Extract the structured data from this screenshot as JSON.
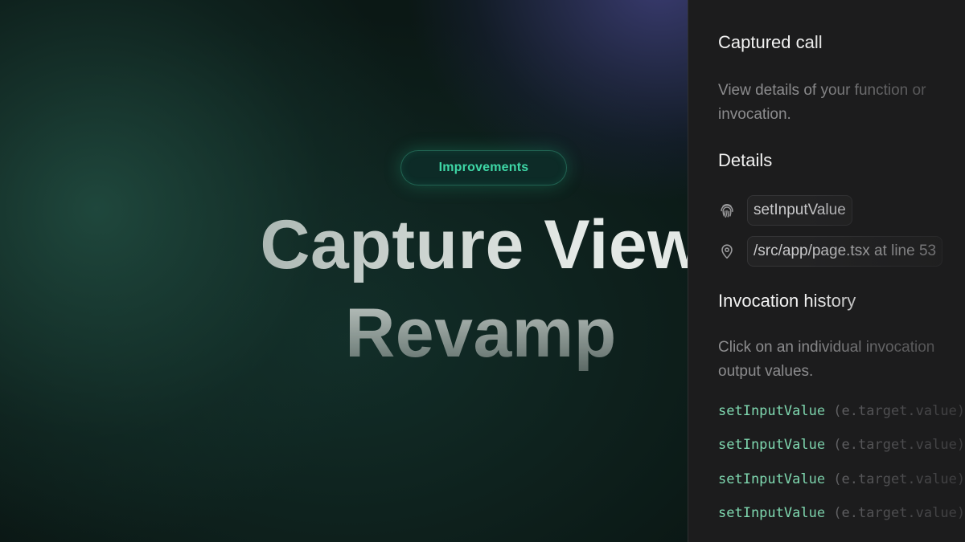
{
  "hero": {
    "badge_label": "Improvements",
    "title_line1": "Capture View",
    "title_line2": "Revamp"
  },
  "panel": {
    "title": "Captured call",
    "description": "View details of your function or invocation.",
    "description_line1": "View details of your function or",
    "description_line2": "invocation.",
    "details_heading": "Details",
    "details": [
      {
        "icon": "fingerprint-icon",
        "value": "setInputValue"
      },
      {
        "icon": "map-pin-icon",
        "value": "/src/app/page.tsx at line 53"
      }
    ],
    "history_heading": "Invocation history",
    "history_text_line1": "Click on an individual invocation",
    "history_text_line2": "output values.",
    "invocations": [
      {
        "fn": "setInputValue",
        "args": " (e.target.value)"
      },
      {
        "fn": "setInputValue",
        "args": " (e.target.value)"
      },
      {
        "fn": "setInputValue",
        "args": " (e.target.value)"
      },
      {
        "fn": "setInputValue",
        "args": " (e.target.value)"
      }
    ]
  },
  "colors": {
    "accent": "#3ed7a6",
    "panel_bg": "#1c1c1d",
    "code_fn": "#7fd8b0"
  }
}
